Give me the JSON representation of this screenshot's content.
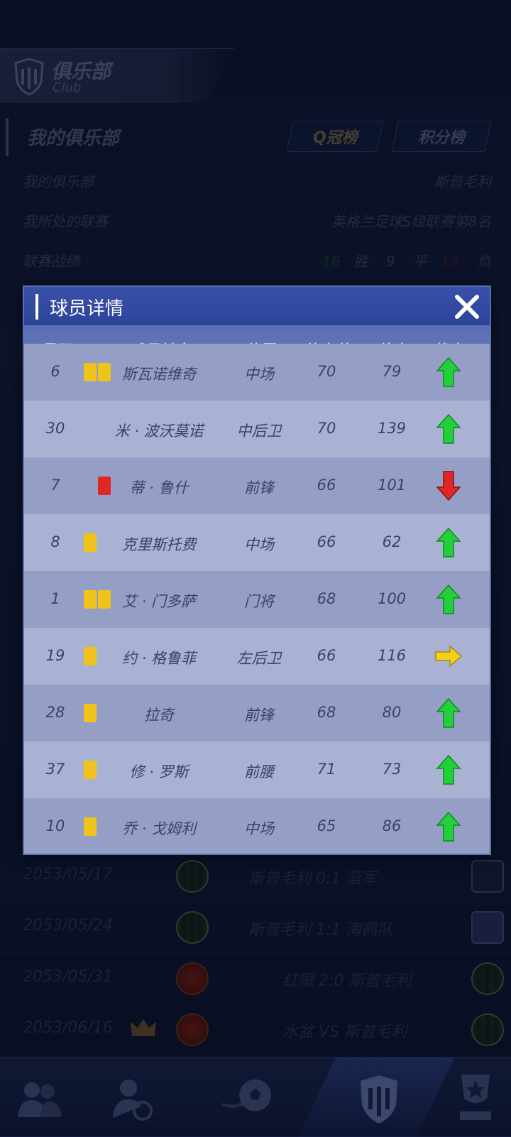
{
  "header": {
    "title_cn": "俱乐部",
    "title_en": "Club"
  },
  "section": {
    "title": "我的俱乐部",
    "tab_q": "Q冠榜",
    "tab_points": "积分榜"
  },
  "info": {
    "my_club_label": "我的俱乐部",
    "my_club_value": "斯普毛利",
    "league_label": "我所处的联赛",
    "league_value": "英格兰足球S级联赛第8名",
    "record_label": "联赛战绩",
    "wins": "16",
    "win_label": "胜",
    "draws": "9",
    "draw_label": "平",
    "losses": "13",
    "loss_label": "负"
  },
  "matches": [
    {
      "date": "2053/05/17",
      "text": "斯普毛利 0:1 蓝军"
    },
    {
      "date": "2053/05/24",
      "text": "斯普毛利 1:1 海鸥队"
    },
    {
      "date": "2053/05/31",
      "text": "红魔 2:0 斯普毛利"
    },
    {
      "date": "2053/06/16",
      "text": "水盆 VS 斯普毛利"
    }
  ],
  "modal": {
    "title": "球员详情",
    "columns": [
      "号码",
      "球员姓名",
      "位置",
      "能力值",
      "体力",
      "状态"
    ],
    "partial_row": {
      "number": "6",
      "name": "斯瓦诺维奇",
      "position": "中场",
      "ability": "70",
      "stamina": "79",
      "cards": [
        "yellow",
        "yellow"
      ],
      "status": "up"
    },
    "players": [
      {
        "number": "30",
        "name": "米 · 波沃莫诺",
        "position": "中后卫",
        "ability": "70",
        "stamina": "139",
        "cards": [],
        "status": "up"
      },
      {
        "number": "7",
        "name": "蒂 · 鲁什",
        "position": "前锋",
        "ability": "66",
        "stamina": "101",
        "cards": [
          "red"
        ],
        "status": "down"
      },
      {
        "number": "8",
        "name": "克里斯托费",
        "position": "中场",
        "ability": "66",
        "stamina": "62",
        "cards": [
          "yellow"
        ],
        "status": "up"
      },
      {
        "number": "1",
        "name": "艾 · 门多萨",
        "position": "门将",
        "ability": "68",
        "stamina": "100",
        "cards": [
          "yellow",
          "yellow"
        ],
        "status": "up"
      },
      {
        "number": "19",
        "name": "约 · 格鲁菲",
        "position": "左后卫",
        "ability": "66",
        "stamina": "116",
        "cards": [
          "yellow"
        ],
        "status": "right"
      },
      {
        "number": "28",
        "name": "拉奇",
        "position": "前锋",
        "ability": "68",
        "stamina": "80",
        "cards": [
          "yellow"
        ],
        "status": "up"
      },
      {
        "number": "37",
        "name": "修 · 罗斯",
        "position": "前腰",
        "ability": "71",
        "stamina": "73",
        "cards": [
          "yellow"
        ],
        "status": "up"
      },
      {
        "number": "10",
        "name": "乔 · 戈姆利",
        "position": "中场",
        "ability": "65",
        "stamina": "86",
        "cards": [
          "yellow"
        ],
        "status": "up"
      }
    ]
  },
  "colors": {
    "status_up": "#22d13a",
    "status_down": "#e02626",
    "status_right": "#f2d21a",
    "yellow_card": "#f0c21c",
    "red_card": "#e02626"
  },
  "bottom_nav": [
    {
      "icon": "players-icon"
    },
    {
      "icon": "transfer-icon"
    },
    {
      "icon": "match-ball-icon"
    },
    {
      "icon": "club-shield-icon"
    },
    {
      "icon": "trophy-icon"
    }
  ]
}
